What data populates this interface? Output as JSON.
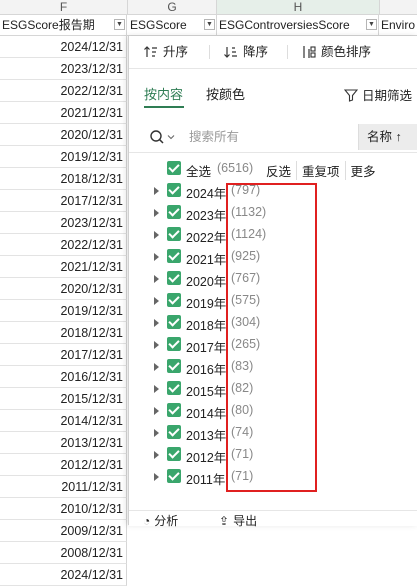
{
  "columns": [
    "F",
    "G",
    "H"
  ],
  "headers": {
    "f": "ESGScore报告期",
    "g": "ESGScore",
    "h": "ESGControversiesScore",
    "i": "Enviro"
  },
  "column_e_values": [
    "2024/12/31",
    "2023/12/31",
    "2022/12/31",
    "2021/12/31",
    "2020/12/31",
    "2019/12/31",
    "2018/12/31",
    "2017/12/31",
    "2023/12/31",
    "2022/12/31",
    "2021/12/31",
    "2020/12/31",
    "2019/12/31",
    "2018/12/31",
    "2017/12/31",
    "2016/12/31",
    "2015/12/31",
    "2014/12/31",
    "2013/12/31",
    "2012/12/31",
    "2011/12/31",
    "2010/12/31",
    "2009/12/31",
    "2008/12/31",
    "2024/12/31"
  ],
  "sortbar": {
    "asc": "升序",
    "desc": "降序",
    "color_sort": "颜色排序"
  },
  "tabs": {
    "by_content": "按内容",
    "by_color": "按颜色",
    "date_filter": "日期筛选"
  },
  "search": {
    "placeholder": "搜索所有",
    "sort_label": "名称"
  },
  "select_all": {
    "label": "全选",
    "count": "(6516)"
  },
  "actions": [
    "反选",
    "重复项",
    "更多"
  ],
  "years": [
    {
      "label": "2024年",
      "count": "(797)"
    },
    {
      "label": "2023年",
      "count": "(1132)"
    },
    {
      "label": "2022年",
      "count": "(1124)"
    },
    {
      "label": "2021年",
      "count": "(925)"
    },
    {
      "label": "2020年",
      "count": "(767)"
    },
    {
      "label": "2019年",
      "count": "(575)"
    },
    {
      "label": "2018年",
      "count": "(304)"
    },
    {
      "label": "2017年",
      "count": "(265)"
    },
    {
      "label": "2016年",
      "count": "(83)"
    },
    {
      "label": "2015年",
      "count": "(82)"
    },
    {
      "label": "2014年",
      "count": "(80)"
    },
    {
      "label": "2013年",
      "count": "(74)"
    },
    {
      "label": "2012年",
      "count": "(71)"
    },
    {
      "label": "2011年",
      "count": "(71)"
    }
  ],
  "footer": {
    "analysis": "分析",
    "export": "导出"
  },
  "colors": {
    "accent": "#2f7d54",
    "checkbox": "#3aa66c",
    "highlight": "#e02020"
  }
}
